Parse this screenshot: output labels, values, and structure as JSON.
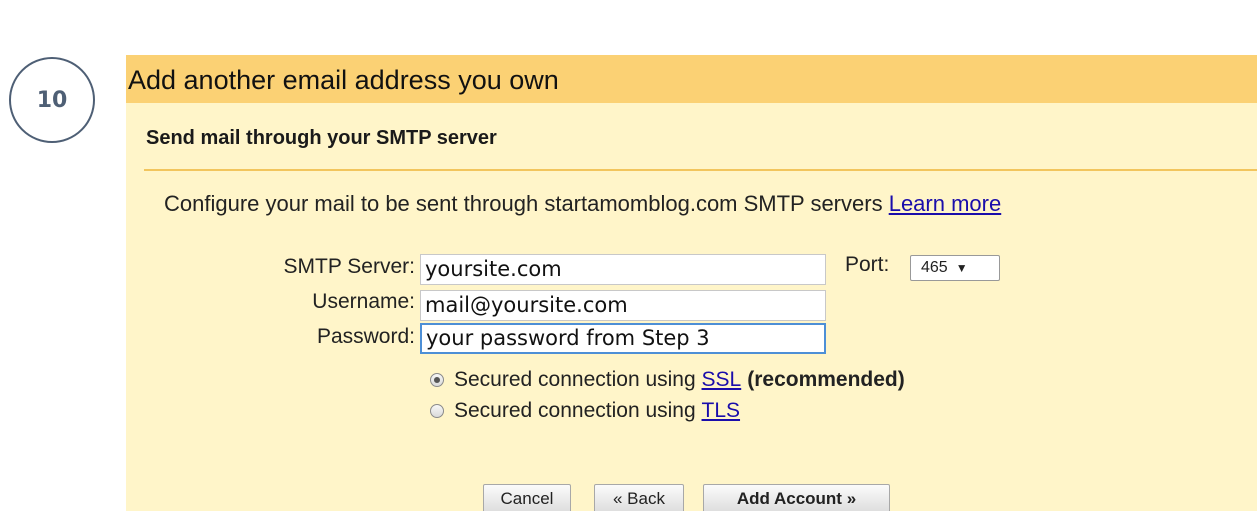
{
  "step_number": "10",
  "dialog": {
    "title": "Add another email address you own",
    "subtitle": "Send mail through your SMTP server",
    "description": "Configure your mail to be sent through startamomblog.com SMTP servers",
    "learn_more": "Learn more"
  },
  "form": {
    "smtp_label": "SMTP Server:",
    "smtp_value": "yoursite.com",
    "username_label": "Username:",
    "username_value": "mail@yoursite.com",
    "password_label": "Password:",
    "password_value": "your password from Step 3",
    "port_label": "Port:",
    "port_value": "465"
  },
  "security": {
    "ssl_prefix": "Secured connection using",
    "ssl_link": "SSL",
    "ssl_suffix": "(recommended)",
    "ssl_selected": true,
    "tls_prefix": "Secured connection using",
    "tls_link": "TLS"
  },
  "buttons": {
    "cancel": "Cancel",
    "back": "« Back",
    "add_account": "Add Account »"
  },
  "colors": {
    "title_bar": "#fbd174",
    "panel_bg": "#fff5c9",
    "link": "#1a0dab",
    "focus_border": "#4d8fd6"
  }
}
